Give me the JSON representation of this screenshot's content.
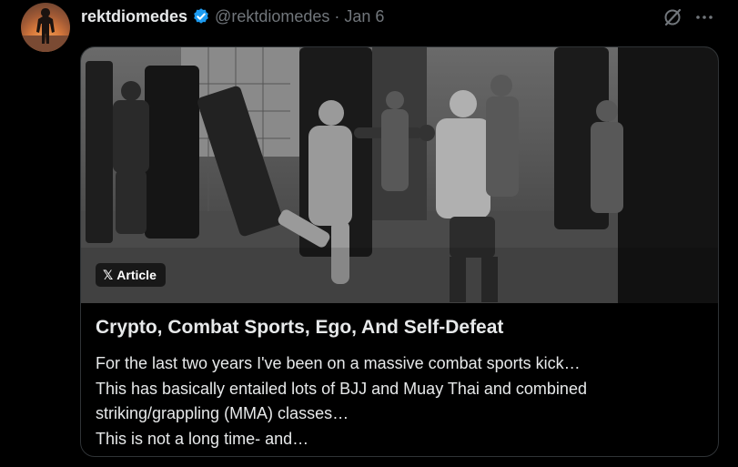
{
  "tweet": {
    "display_name": "rektdiomedes",
    "handle": "@rektdiomedes",
    "separator": "·",
    "date": "Jan 6"
  },
  "icons": {
    "verified": "verified-badge-icon",
    "grok": "grok-icon",
    "more": "more-options-icon",
    "x_logo": "x-logo-icon"
  },
  "colors": {
    "verified_blue": "#1d9bf0",
    "text_primary": "#e7e9ea",
    "text_secondary": "#71767b",
    "border": "#2f3336"
  },
  "card": {
    "badge_label": "Article",
    "badge_glyph": "𝕏",
    "title": "Crypto, Combat Sports, Ego, And Self-Defeat",
    "description_lines": [
      "For the last two years I've been on a massive combat sports kick…",
      "This has basically entailed lots of BJJ and Muay Thai and combined",
      "striking/grappling (MMA) classes…",
      "This is not a long time- and…"
    ]
  }
}
